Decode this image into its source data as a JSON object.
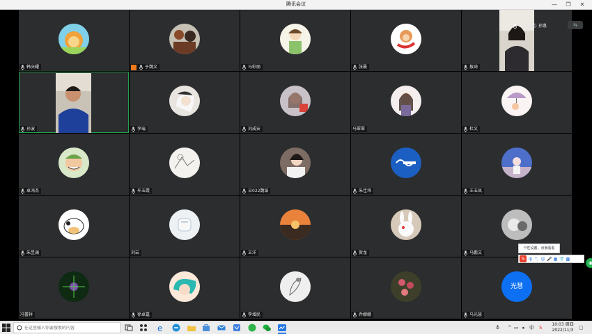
{
  "window": {
    "title": "腾讯会议",
    "minimize": "—",
    "restore": "❐",
    "close": "✕"
  },
  "colors": {
    "tile": "#2b2d2f",
    "active_border": "#21a24b",
    "text_avatar": "#0d6ff2",
    "taskbar": "#ececec"
  },
  "speaking": {
    "label": "正在讲话: 孙惠"
  },
  "participants": [
    {
      "name": "韩庆耀",
      "avatar": "lion-cartoon-avatar-icon",
      "mic": true
    },
    {
      "name": "于魏文",
      "avatar": "anime-group-avatar-icon",
      "mic": true,
      "host": true
    },
    {
      "name": "马彩丽",
      "avatar": "drawn-girl-avatar-icon",
      "mic": true
    },
    {
      "name": "张晨",
      "avatar": "monkey-cartoon-avatar-icon",
      "mic": true
    },
    {
      "name": "敖琦",
      "avatar": "video-woman",
      "mic": true,
      "video": true
    },
    {
      "name": "孙波",
      "avatar": "video-man",
      "mic": true,
      "video": true,
      "active": true
    },
    {
      "name": "李瑞",
      "avatar": "white-hair-anime-avatar-icon",
      "mic": true
    },
    {
      "name": "刘成安",
      "avatar": "girl-photo-avatar-icon",
      "mic": true
    },
    {
      "name": "马翠翠",
      "avatar": "girl-cartoon-avatar-icon",
      "mic": false
    },
    {
      "name": "杜文",
      "avatar": "umbrella-girl-avatar-icon",
      "mic": true
    },
    {
      "name": "卓鸿杰",
      "avatar": "zoro-cartoon-avatar-icon",
      "mic": true
    },
    {
      "name": "牟玉霞",
      "avatar": "sketch-avatar-icon",
      "mic": true
    },
    {
      "name": "日022魏铂",
      "avatar": "woman-photo-avatar-icon",
      "mic": true
    },
    {
      "name": "朱佳玮",
      "avatar": "blue-logo-avatar-icon",
      "mic": true
    },
    {
      "name": "王玉凤",
      "avatar": "child-photo-avatar-icon",
      "mic": true
    },
    {
      "name": "朱昱澜",
      "avatar": "cow-cartoon-avatar-icon",
      "mic": true
    },
    {
      "name": "刘岩",
      "avatar": "white-cat-avatar-icon",
      "mic": false
    },
    {
      "name": "王洋",
      "avatar": "sunset-avatar-icon",
      "mic": true
    },
    {
      "name": "贺龙",
      "avatar": "rabbit-avatar-icon",
      "mic": true
    },
    {
      "name": "马鹏文",
      "avatar": "mono-photo-avatar-icon",
      "mic": true
    },
    {
      "name": "冯蕾祥",
      "avatar": "green-sparkle-avatar-icon",
      "mic": false
    },
    {
      "name": "徐卓嘉",
      "avatar": "teal-hair-anime-avatar-icon",
      "mic": true
    },
    {
      "name": "李增民",
      "avatar": "bird-sketch-avatar-icon",
      "mic": true
    },
    {
      "name": "乔娜娜",
      "avatar": "flower-photo-avatar-icon",
      "mic": true
    },
    {
      "name": "马光慧",
      "avatar": "text-avatar",
      "avatar_text": "光慧",
      "mic": true
    }
  ],
  "popup": {
    "tooltip": "个性设置，点我看看",
    "ime_logo": "S",
    "ime_items": [
      "中",
      "°,",
      "☺",
      "🎤",
      "▦",
      "👕",
      "▩"
    ]
  },
  "taskbar": {
    "search_placeholder": "在这里输入你要搜索的内容",
    "tray": {
      "people": "⛢",
      "chevron": "^",
      "input_lang": "中",
      "s_icon": "S"
    },
    "time": "10:03",
    "weekday": "周四",
    "date": "2022/11/3"
  }
}
